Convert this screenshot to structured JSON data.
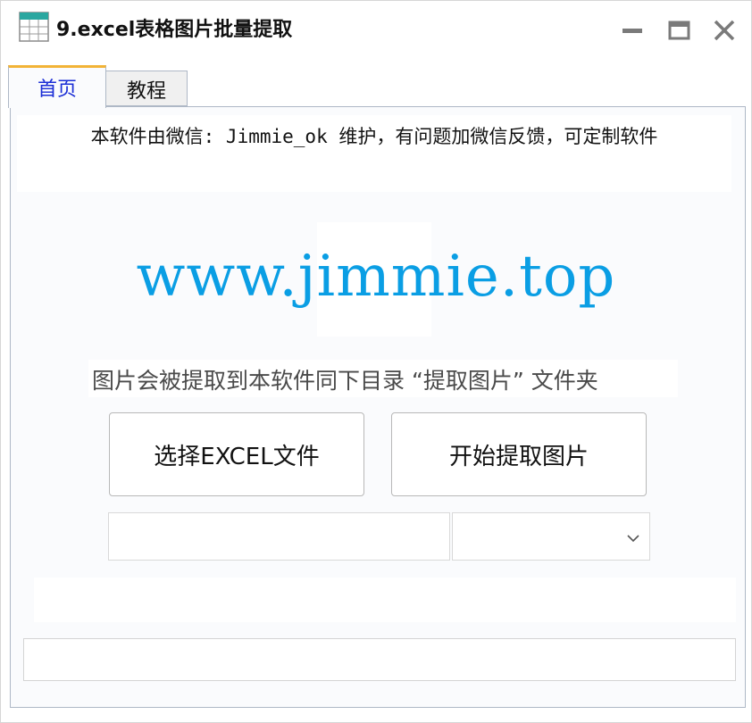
{
  "window": {
    "title": "9.excel表格图片批量提取",
    "icon": "spreadsheet-icon",
    "controls": [
      "minimize-icon",
      "maximize-icon",
      "close-icon"
    ]
  },
  "tabs": [
    {
      "label": "首页",
      "active": true
    },
    {
      "label": "教程",
      "active": false
    }
  ],
  "home": {
    "notice": "本软件由微信: Jimmie_ok 维护，有问题加微信反馈，可定制软件",
    "website": "www.jimmie.top",
    "hint": "图片会被提取到本软件同下目录 “提取图片” 文件夹",
    "select_button": "选择EXCEL文件",
    "start_button": "开始提取图片",
    "file_path_value": "",
    "sheet_select_value": "",
    "status_value": ""
  },
  "colors": {
    "website": "#0a9ee4",
    "active_tab_text": "#1a2dd6",
    "active_tab_accent": "#f2b336",
    "panel_bg": "#fafbfd"
  }
}
